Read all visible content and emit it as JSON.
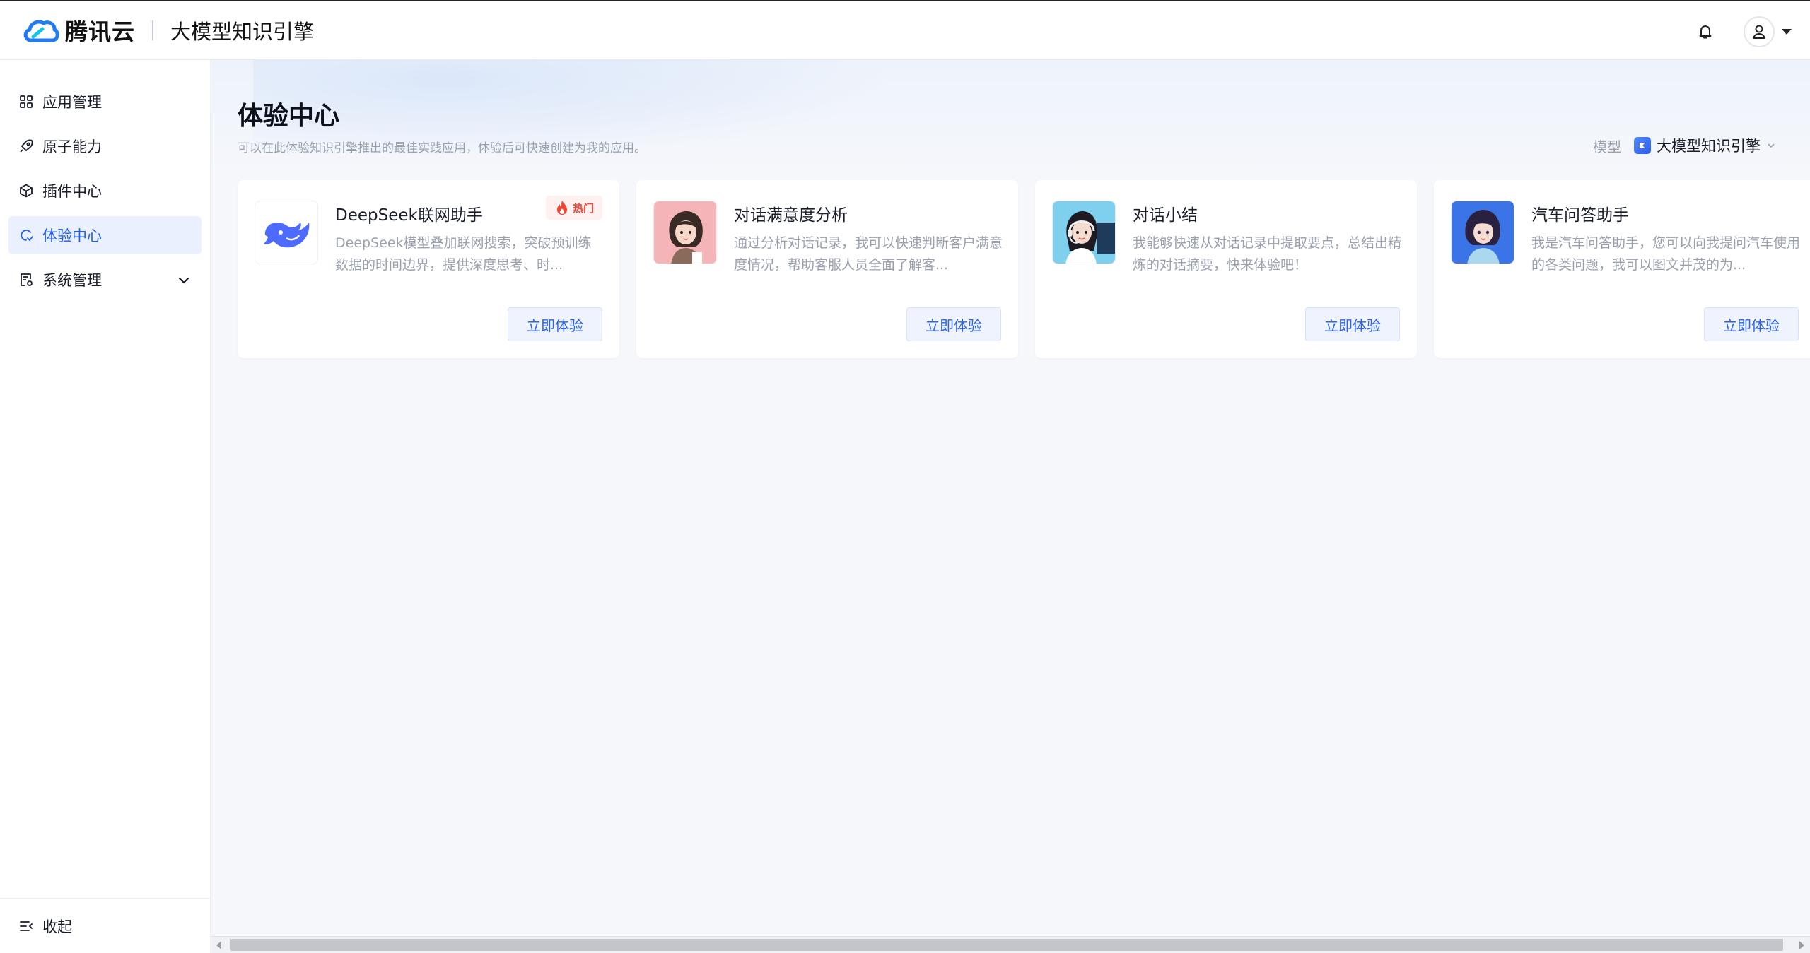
{
  "header": {
    "brand": "腾讯云",
    "product": "大模型知识引擎"
  },
  "sidebar": {
    "items": [
      {
        "label": "应用管理",
        "icon": "grid-icon"
      },
      {
        "label": "原子能力",
        "icon": "rocket-icon"
      },
      {
        "label": "插件中心",
        "icon": "cube-icon"
      },
      {
        "label": "体验中心",
        "icon": "experience-icon",
        "active": true
      },
      {
        "label": "系统管理",
        "icon": "settings-doc-icon",
        "expandable": true
      }
    ],
    "collapse_label": "收起"
  },
  "main": {
    "title": "体验中心",
    "description": "可以在此体验知识引擎推出的最佳实践应用，体验后可快速创建为我的应用。",
    "model_label": "模型",
    "model_value": "大模型知识引擎",
    "cards": [
      {
        "title": "DeepSeek联网助手",
        "description": "DeepSeek模型叠加联网搜索，突破预训练数据的时间边界，提供深度思考、时...",
        "badge": "热门",
        "button": "立即体验",
        "avatar": "deepseek-whale-logo"
      },
      {
        "title": "对话满意度分析",
        "description": "通过分析对话记录，我可以快速判断客户满意度情况，帮助客服人员全面了解客...",
        "button": "立即体验",
        "avatar": "girl-avatar-pink"
      },
      {
        "title": "对话小结",
        "description": "我能够快速从对话记录中提取要点，总结出精炼的对话摘要，快来体验吧！",
        "button": "立即体验",
        "avatar": "headset-agent-avatar"
      },
      {
        "title": "汽车问答助手",
        "description": "我是汽车问答助手，您可以向我提问汽车使用的各类问题，我可以图文并茂的为...",
        "button": "立即体验",
        "avatar": "girl-avatar-blue"
      }
    ]
  },
  "colors": {
    "accent": "#1f5cf0",
    "hot": "#f04438"
  }
}
